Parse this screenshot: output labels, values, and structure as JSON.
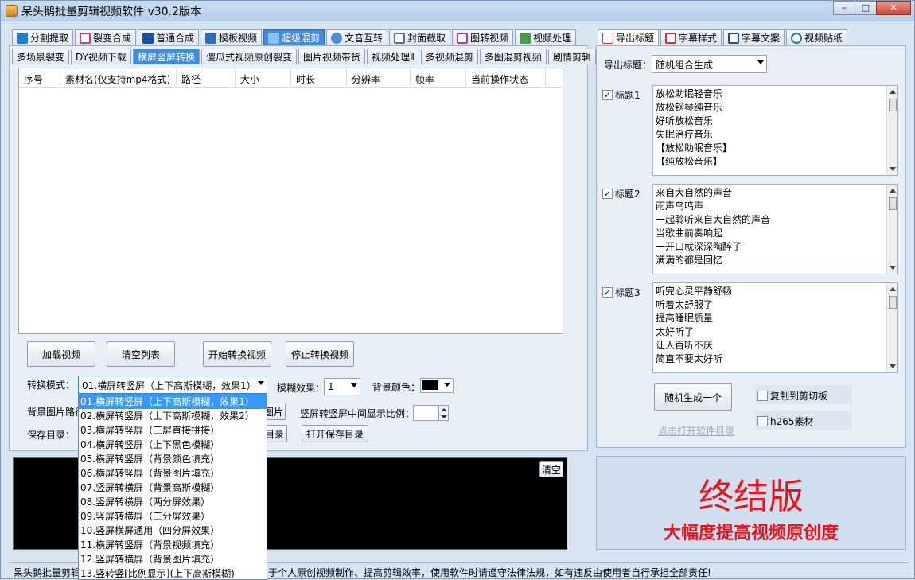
{
  "app": {
    "title": "呆头鹅批量剪辑视频软件    v30.2版本"
  },
  "window_buttons": {
    "min": "–",
    "max": "□",
    "close": "✕"
  },
  "main_tabs": [
    {
      "label": "分割提取",
      "color": "#1f7dd6"
    },
    {
      "label": "裂变合成",
      "color": "#d63a6a"
    },
    {
      "label": "普通合成",
      "color": "#1a4fa0"
    },
    {
      "label": "模板视频",
      "color": "#2b6fb5"
    },
    {
      "label": "超级混剪",
      "color": "#e8f2ff"
    },
    {
      "label": "文音互转",
      "color": "#4a8fd6"
    },
    {
      "label": "封面截取",
      "color": "#5a6f8a"
    },
    {
      "label": "图转视频",
      "color": "#b03aa0"
    },
    {
      "label": "视频处理",
      "color": "#4a9a4a"
    }
  ],
  "sub_tabs": [
    "多场景裂变",
    "DY视频下载",
    "横屏竖屏转换",
    "傻瓜式视频原创裂变",
    "图片视频带货",
    "视频处理Ⅱ",
    "多视频混剪",
    "多图混剪视频",
    "剧情剪辑"
  ],
  "table": {
    "columns": [
      "序号",
      "素材名(仅支持mp4格式)",
      "路径",
      "大小",
      "时长",
      "分辨率",
      "帧率",
      "当前操作状态"
    ]
  },
  "buttons": {
    "load": "加载视频",
    "clear_list": "清空列表",
    "start": "开始转换视频",
    "stop": "停止转换视频",
    "image_btn": "图片",
    "dir_btn": "目录",
    "open_save_dir": "打开保存目录",
    "clear_console": "清空",
    "random_gen": "随机生成一个"
  },
  "form": {
    "mode_label": "转换模式：",
    "mode_value": "01.横屏转竖屏（上下高斯模糊，效果1）",
    "blur_label": "模糊效果：",
    "blur_value": "1",
    "bg_color_label": "背景颜色：",
    "bg_color": "#000000",
    "bg_image_label": "背景图片路径",
    "ratio_label": "竖屏转竖屏中间显示比例：",
    "save_dir_label": "保存目录："
  },
  "dropdown_options": [
    "01.横屏转竖屏（上下高斯模糊，效果1）",
    "02.横屏转竖屏（上下高斯模糊，效果2）",
    "03.横屏转竖屏（三屏直接拼接）",
    "04.横屏转竖屏（上下黑色模糊）",
    "05.横屏转竖屏（背景颜色填充）",
    "06.横屏转竖屏（背景图片填充）",
    "07.竖屏转横屏（背景高斯模糊）",
    "08.竖屏转横屏（两分屏效果）",
    "09.竖屏转横屏（三分屏效果）",
    "10.竖屏横屏通用（四分屏效果）",
    "11.横屏转竖屏（背景视频填充）",
    "12.竖屏转横屏（背景图片填充）",
    "13.竖转竖[比例显示](上下高斯模糊)"
  ],
  "right_tabs": [
    "导出标题",
    "字幕样式",
    "字幕文案",
    "视频贴纸"
  ],
  "export": {
    "label": "导出标题：",
    "value": "随机组合生成"
  },
  "titles": [
    {
      "label": "标题1",
      "checked": true,
      "lines": [
        "放松助眠轻音乐",
        "放松钢琴纯音乐",
        "好听放松音乐",
        "失眠治疗音乐",
        "【放松助眠音乐】",
        "【纯放松音乐】"
      ]
    },
    {
      "label": "标题2",
      "checked": true,
      "lines": [
        "来自大自然的声音",
        "雨声鸟鸣声",
        "一起聆听来自大自然的声音",
        "当歌曲前奏响起",
        "一开口就深深陶醉了",
        "满满的都是回忆"
      ]
    },
    {
      "label": "标题3",
      "checked": true,
      "lines": [
        "听完心灵平静舒畅",
        "听着太舒服了",
        "提高睡眠质量",
        "太好听了",
        "让人百听不厌",
        "简直不要太好听"
      ]
    }
  ],
  "options": {
    "copy_clipboard": "复制到剪切板",
    "h265": "h265素材",
    "open_dir_link": "点击打开软件目录"
  },
  "promo": {
    "title": "终结版",
    "subtitle": "大幅度提高视频原创度"
  },
  "status_bar": {
    "left": "呆头鹅批量剪辑",
    "right": "于个人原创视频制作、提高剪辑效率，使用软件时请遵守法律法规，如有违反由使用者自行承担全部责任!"
  }
}
